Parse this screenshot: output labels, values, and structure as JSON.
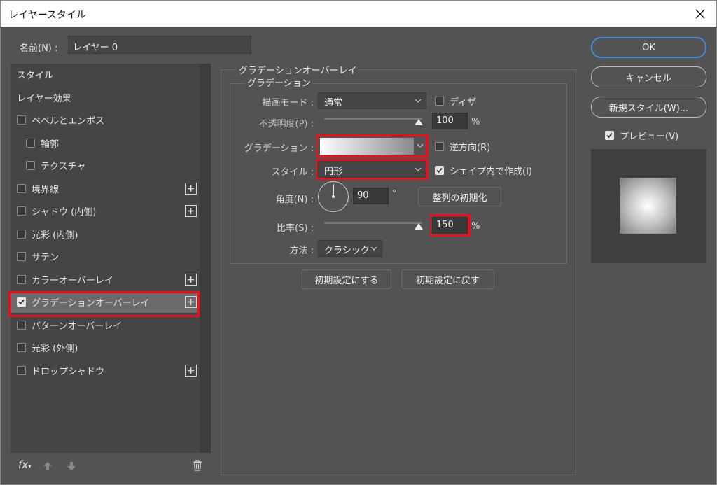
{
  "dialog": {
    "title": "レイヤースタイル"
  },
  "name": {
    "label": "名前(N) :",
    "value": "レイヤー 0"
  },
  "left_panel": {
    "items": [
      {
        "label": "スタイル",
        "checkbox": false,
        "checked": false,
        "plus": false,
        "indent": false
      },
      {
        "label": "レイヤー効果",
        "checkbox": false,
        "checked": false,
        "plus": false,
        "indent": false
      },
      {
        "label": "ベベルとエンボス",
        "checkbox": true,
        "checked": false,
        "plus": false,
        "indent": false
      },
      {
        "label": "輪郭",
        "checkbox": true,
        "checked": false,
        "plus": false,
        "indent": true
      },
      {
        "label": "テクスチャ",
        "checkbox": true,
        "checked": false,
        "plus": false,
        "indent": true
      },
      {
        "label": "境界線",
        "checkbox": true,
        "checked": false,
        "plus": true,
        "indent": false
      },
      {
        "label": "シャドウ (内側)",
        "checkbox": true,
        "checked": false,
        "plus": true,
        "indent": false
      },
      {
        "label": "光彩 (内側)",
        "checkbox": true,
        "checked": false,
        "plus": false,
        "indent": false
      },
      {
        "label": "サテン",
        "checkbox": true,
        "checked": false,
        "plus": false,
        "indent": false
      },
      {
        "label": "カラーオーバーレイ",
        "checkbox": true,
        "checked": false,
        "plus": true,
        "indent": false
      },
      {
        "label": "グラデーションオーバーレイ",
        "checkbox": true,
        "checked": true,
        "plus": true,
        "indent": false,
        "selected": true
      },
      {
        "label": "パターンオーバーレイ",
        "checkbox": true,
        "checked": false,
        "plus": false,
        "indent": false
      },
      {
        "label": "光彩 (外側)",
        "checkbox": true,
        "checked": false,
        "plus": false,
        "indent": false
      },
      {
        "label": "ドロップシャドウ",
        "checkbox": true,
        "checked": false,
        "plus": true,
        "indent": false
      }
    ],
    "fx_label": "fx"
  },
  "settings": {
    "group_title": "グラデーションオーバーレイ",
    "subgroup_title": "グラデーション",
    "blend_mode": {
      "label": "描画モード :",
      "value": "通常"
    },
    "dither": {
      "label": "ディザ",
      "checked": false
    },
    "opacity": {
      "label": "不透明度(P) :",
      "value": "100",
      "unit": "%",
      "level": 100
    },
    "gradient": {
      "label": "グラデーション :"
    },
    "reverse": {
      "label": "逆方向(R)",
      "checked": false
    },
    "style": {
      "label": "スタイル :",
      "value": "円形"
    },
    "align_shape": {
      "label": "シェイプ内で作成(I)",
      "checked": true
    },
    "angle": {
      "label": "角度(N) :",
      "value": "90",
      "unit": "°",
      "degrees": 90
    },
    "reset_align_button": "整列の初期化",
    "scale": {
      "label": "比率(S) :",
      "value": "150",
      "unit": "%",
      "level": 150
    },
    "method": {
      "label": "方法 :",
      "value": "クラシック"
    },
    "make_default_button": "初期設定にする",
    "reset_default_button": "初期設定に戻す"
  },
  "right_panel": {
    "ok": "OK",
    "cancel": "キャンセル",
    "new_style": "新規スタイル(W)...",
    "preview": {
      "label": "プレビュー(V)",
      "checked": true
    }
  },
  "colors": {
    "highlight": "#e0141f",
    "ok_border": "#4a8bdb"
  }
}
